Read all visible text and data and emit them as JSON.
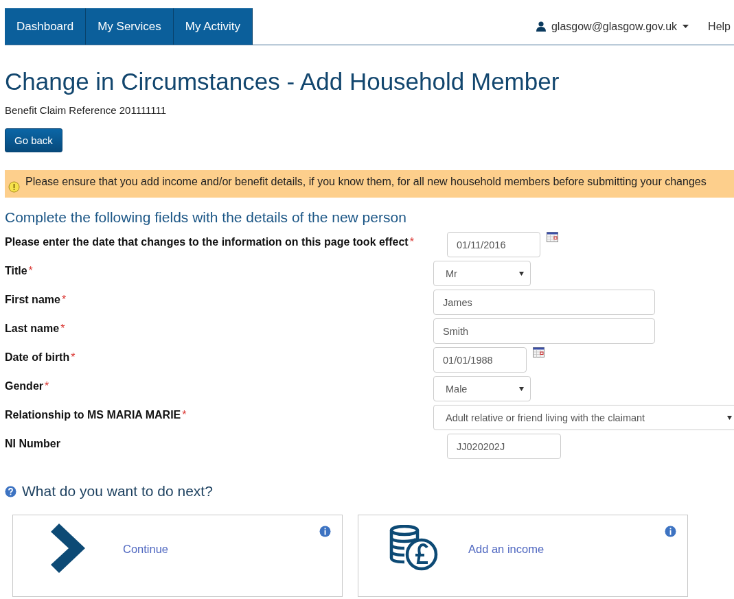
{
  "nav": {
    "tabs": [
      {
        "label": "Dashboard",
        "selected": false
      },
      {
        "label": "My Services",
        "selected": false
      },
      {
        "label": "My Activity",
        "selected": false
      }
    ],
    "user": "glasgow@glasgow.gov.uk",
    "help": "Help"
  },
  "title": "Change in Circumstances - Add Household Member",
  "reference": "Benefit Claim Reference 201111111",
  "back_button": "Go back",
  "alert": "Please ensure that you add income and/or benefit details, if you know them, for all new household members before submitting your changes",
  "form": {
    "heading": "Complete the following fields with the details of the new person",
    "fields": [
      {
        "label": "Please enter the date that changes to the information on this page took effect",
        "required_mark": "*",
        "kind": "date",
        "value": "01/11/2016"
      },
      {
        "label": "Title",
        "required_mark": "*",
        "kind": "short-select",
        "value": "Mr"
      },
      {
        "label": "First name",
        "required_mark": "*",
        "kind": "text",
        "value": "James"
      },
      {
        "label": "Last name",
        "required_mark": "*",
        "kind": "text",
        "value": "Smith"
      },
      {
        "label": "Date of birth",
        "required_mark": "*",
        "kind": "date",
        "value": "01/01/1988"
      },
      {
        "label": "Gender",
        "required_mark": "*",
        "kind": "short-select",
        "value": "Male"
      },
      {
        "label": "Relationship to MS MARIA MARIE",
        "required_mark": "*",
        "kind": "long-select",
        "value": "Adult relative or friend living with the claimant"
      },
      {
        "label": "NI Number",
        "kind": "code",
        "value": "JJ020202J"
      }
    ]
  },
  "next": {
    "heading": "What do you want to do next?",
    "options": [
      {
        "kind": "continue",
        "label": "Continue"
      },
      {
        "kind": "income",
        "label": "Add an income"
      }
    ]
  }
}
